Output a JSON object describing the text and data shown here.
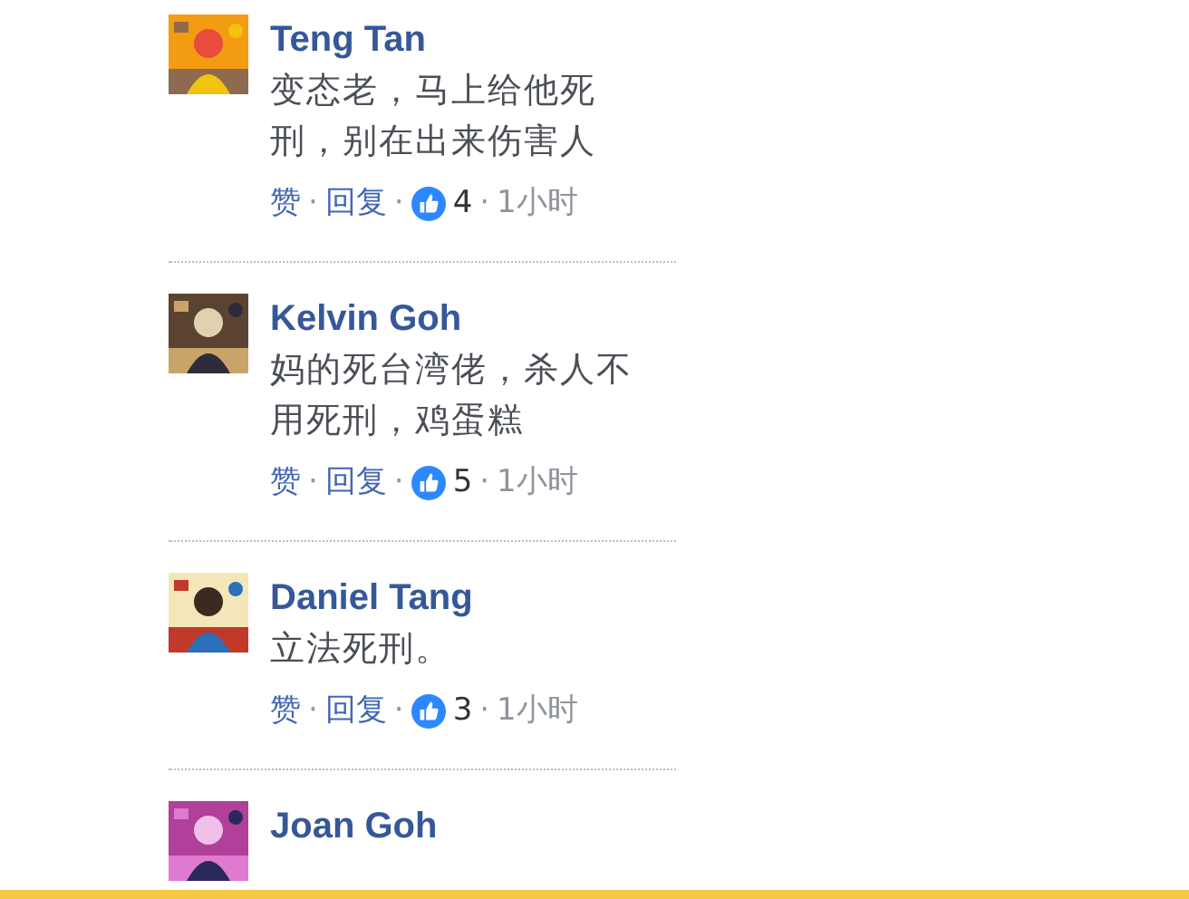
{
  "comments": [
    {
      "author": "Teng Tan",
      "text": "变态老，马上给他死刑，别在出来伤害人",
      "like_label": "赞",
      "sep": "·",
      "reply_label": "回复",
      "likes": "4",
      "time": "1小时"
    },
    {
      "author": "Kelvin Goh",
      "text": "妈的死台湾佬，杀人不用死刑，鸡蛋糕",
      "like_label": "赞",
      "sep": "·",
      "reply_label": "回复",
      "likes": "5",
      "time": "1小时"
    },
    {
      "author": "Daniel Tang",
      "text": "立法死刑。",
      "like_label": "赞",
      "sep": "·",
      "reply_label": "回复",
      "likes": "3",
      "time": "1小时"
    },
    {
      "author": "Joan Goh"
    }
  ]
}
